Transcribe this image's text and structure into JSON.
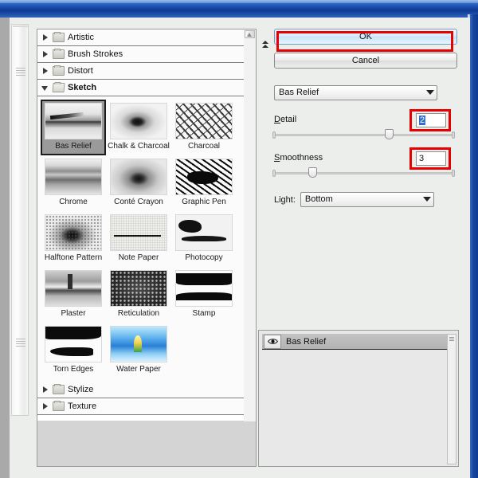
{
  "window": {
    "chrome_color": "#17459e"
  },
  "browser": {
    "tree": [
      {
        "label": "Artistic",
        "expanded": false,
        "icon": "folder-icon",
        "twisty": "triangle-right-icon"
      },
      {
        "label": "Brush Strokes",
        "expanded": false,
        "icon": "folder-icon",
        "twisty": "triangle-right-icon"
      },
      {
        "label": "Distort",
        "expanded": false,
        "icon": "folder-icon",
        "twisty": "triangle-right-icon"
      },
      {
        "label": "Sketch",
        "expanded": true,
        "icon": "folder-open-icon",
        "twisty": "triangle-down-icon"
      }
    ],
    "tree_bottom": [
      {
        "label": "Stylize",
        "expanded": false,
        "icon": "folder-icon",
        "twisty": "triangle-right-icon"
      },
      {
        "label": "Texture",
        "expanded": false,
        "icon": "folder-icon",
        "twisty": "triangle-right-icon"
      }
    ],
    "filters": [
      {
        "label": "Bas Relief",
        "art": "t-basrelief",
        "selected": true
      },
      {
        "label": "Chalk & Charcoal",
        "art": "t-chalk",
        "selected": false
      },
      {
        "label": "Charcoal",
        "art": "t-charcoal",
        "selected": false
      },
      {
        "label": "Chrome",
        "art": "t-chrome",
        "selected": false
      },
      {
        "label": "Conté Crayon",
        "art": "t-conte",
        "selected": false
      },
      {
        "label": "Graphic Pen",
        "art": "t-graphicpen",
        "selected": false
      },
      {
        "label": "Halftone Pattern",
        "art": "t-halftone",
        "selected": false
      },
      {
        "label": "Note Paper",
        "art": "t-notepaper",
        "selected": false
      },
      {
        "label": "Photocopy",
        "art": "t-photocopy",
        "selected": false
      },
      {
        "label": "Plaster",
        "art": "t-plaster",
        "selected": false
      },
      {
        "label": "Reticulation",
        "art": "t-reticulation",
        "selected": false
      },
      {
        "label": "Stamp",
        "art": "t-stamp",
        "selected": false
      },
      {
        "label": "Torn Edges",
        "art": "t-tornedges",
        "selected": false
      },
      {
        "label": "Water Paper",
        "art": "t-waterpaper",
        "selected": false
      }
    ]
  },
  "settings": {
    "ok_label": "OK",
    "cancel_label": "Cancel",
    "filter_select": {
      "value": "Bas Relief"
    },
    "detail": {
      "label": "Detail",
      "value": "2",
      "selected": true,
      "slider_percent": 65
    },
    "smoothness": {
      "label": "Smoothness",
      "value": "3",
      "selected": false,
      "slider_percent": 20
    },
    "light": {
      "label": "Light:",
      "value": "Bottom"
    },
    "highlight_color": "#e60000"
  },
  "layers": {
    "items": [
      {
        "name": "Bas Relief",
        "visible": true,
        "selected": true
      }
    ]
  }
}
